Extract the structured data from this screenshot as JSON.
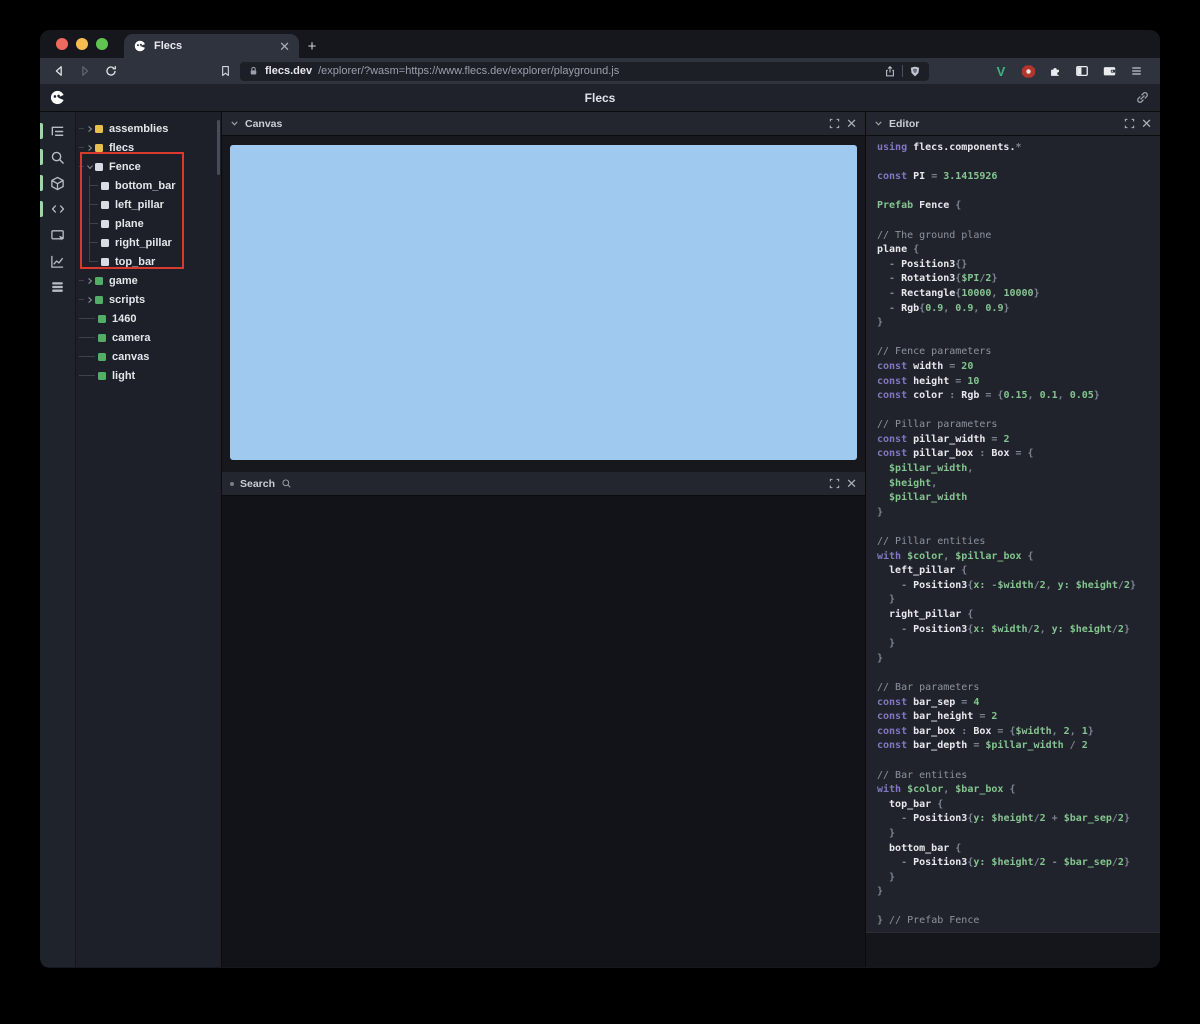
{
  "browser": {
    "tab_title": "Flecs",
    "new_tab_label": "+",
    "url_domain": "flecs.dev",
    "url_path": "/explorer/?wasm=https://www.flecs.dev/explorer/playground.js",
    "extensions": {
      "v_label": "V"
    }
  },
  "header": {
    "title": "Flecs"
  },
  "sidebar": {
    "items": [
      {
        "icon": "tree-view",
        "active": true
      },
      {
        "icon": "search",
        "active": true
      },
      {
        "icon": "cube",
        "active": true
      },
      {
        "icon": "code",
        "active": true
      },
      {
        "icon": "inspect",
        "active": false
      },
      {
        "icon": "chart",
        "active": false
      },
      {
        "icon": "rows",
        "active": false
      }
    ]
  },
  "tree": {
    "items": [
      {
        "label": "assemblies",
        "square": "yellow",
        "state": "collapsed"
      },
      {
        "label": "flecs",
        "square": "yellow",
        "state": "collapsed"
      },
      {
        "label": "Fence",
        "square": "white",
        "state": "expanded"
      },
      {
        "label": "bottom_bar",
        "square": "white",
        "state": "child"
      },
      {
        "label": "left_pillar",
        "square": "white",
        "state": "child"
      },
      {
        "label": "plane",
        "square": "white",
        "state": "child"
      },
      {
        "label": "right_pillar",
        "square": "white",
        "state": "child"
      },
      {
        "label": "top_bar",
        "square": "white",
        "state": "child-last"
      },
      {
        "label": "game",
        "square": "green",
        "state": "collapsed"
      },
      {
        "label": "scripts",
        "square": "green",
        "state": "collapsed"
      },
      {
        "label": "1460",
        "square": "green",
        "state": "leaf"
      },
      {
        "label": "camera",
        "square": "green",
        "state": "leaf"
      },
      {
        "label": "canvas",
        "square": "green",
        "state": "leaf"
      },
      {
        "label": "light",
        "square": "green",
        "state": "leaf"
      }
    ]
  },
  "panels": {
    "canvas_title": "Canvas",
    "search_title": "Search",
    "editor_title": "Editor"
  },
  "editor": {
    "lines": [
      [
        [
          "k",
          "using "
        ],
        [
          "i",
          "flecs.components."
        ],
        [
          "p",
          "*"
        ]
      ],
      [],
      [
        [
          "k",
          "const "
        ],
        [
          "i",
          "PI"
        ],
        [
          "p",
          " = "
        ],
        [
          "g",
          "3.1415926"
        ]
      ],
      [],
      [
        [
          "g",
          "Prefab "
        ],
        [
          "i",
          "Fence"
        ],
        [
          "p",
          " {"
        ]
      ],
      [],
      [
        [
          "c",
          "// The ground plane"
        ]
      ],
      [
        [
          "i",
          "plane"
        ],
        [
          "p",
          " {"
        ]
      ],
      [
        [
          "p",
          "  - "
        ],
        [
          "i",
          "Position3"
        ],
        [
          "p",
          "{}"
        ]
      ],
      [
        [
          "p",
          "  - "
        ],
        [
          "i",
          "Rotation3"
        ],
        [
          "p",
          "{"
        ],
        [
          "g",
          "$PI"
        ],
        [
          "p",
          "/"
        ],
        [
          "g",
          "2"
        ],
        [
          "p",
          "}"
        ]
      ],
      [
        [
          "p",
          "  - "
        ],
        [
          "i",
          "Rectangle"
        ],
        [
          "p",
          "{"
        ],
        [
          "g",
          "10000"
        ],
        [
          "p",
          ", "
        ],
        [
          "g",
          "10000"
        ],
        [
          "p",
          "}"
        ]
      ],
      [
        [
          "p",
          "  - "
        ],
        [
          "i",
          "Rgb"
        ],
        [
          "p",
          "{"
        ],
        [
          "g",
          "0.9"
        ],
        [
          "p",
          ", "
        ],
        [
          "g",
          "0.9"
        ],
        [
          "p",
          ", "
        ],
        [
          "g",
          "0.9"
        ],
        [
          "p",
          "}"
        ]
      ],
      [
        [
          "p",
          "}"
        ]
      ],
      [],
      [
        [
          "c",
          "// Fence parameters"
        ]
      ],
      [
        [
          "k",
          "const "
        ],
        [
          "i",
          "width"
        ],
        [
          "p",
          " = "
        ],
        [
          "g",
          "20"
        ]
      ],
      [
        [
          "k",
          "const "
        ],
        [
          "i",
          "height"
        ],
        [
          "p",
          " = "
        ],
        [
          "g",
          "10"
        ]
      ],
      [
        [
          "k",
          "const "
        ],
        [
          "i",
          "color"
        ],
        [
          "p",
          " : "
        ],
        [
          "i",
          "Rgb"
        ],
        [
          "p",
          " = {"
        ],
        [
          "g",
          "0.15"
        ],
        [
          "p",
          ", "
        ],
        [
          "g",
          "0.1"
        ],
        [
          "p",
          ", "
        ],
        [
          "g",
          "0.05"
        ],
        [
          "p",
          "}"
        ]
      ],
      [],
      [
        [
          "c",
          "// Pillar parameters"
        ]
      ],
      [
        [
          "k",
          "const "
        ],
        [
          "i",
          "pillar_width"
        ],
        [
          "p",
          " = "
        ],
        [
          "g",
          "2"
        ]
      ],
      [
        [
          "k",
          "const "
        ],
        [
          "i",
          "pillar_box"
        ],
        [
          "p",
          " : "
        ],
        [
          "i",
          "Box"
        ],
        [
          "p",
          " = {"
        ]
      ],
      [
        [
          "g",
          "  $pillar_width"
        ],
        [
          "p",
          ","
        ]
      ],
      [
        [
          "g",
          "  $height"
        ],
        [
          "p",
          ","
        ]
      ],
      [
        [
          "g",
          "  $pillar_width"
        ]
      ],
      [
        [
          "p",
          "}"
        ]
      ],
      [],
      [
        [
          "c",
          "// Pillar entities"
        ]
      ],
      [
        [
          "k",
          "with "
        ],
        [
          "g",
          "$color"
        ],
        [
          "p",
          ", "
        ],
        [
          "g",
          "$pillar_box"
        ],
        [
          "p",
          " {"
        ]
      ],
      [
        [
          "i",
          "  left_pillar"
        ],
        [
          "p",
          " {"
        ]
      ],
      [
        [
          "p",
          "    - "
        ],
        [
          "i",
          "Position3"
        ],
        [
          "p",
          "{"
        ],
        [
          "g",
          "x:"
        ],
        [
          "p",
          " -"
        ],
        [
          "g",
          "$width"
        ],
        [
          "p",
          "/"
        ],
        [
          "g",
          "2"
        ],
        [
          "p",
          ", "
        ],
        [
          "g",
          "y:"
        ],
        [
          "p",
          " "
        ],
        [
          "g",
          "$height"
        ],
        [
          "p",
          "/"
        ],
        [
          "g",
          "2"
        ],
        [
          "p",
          "}"
        ]
      ],
      [
        [
          "p",
          "  }"
        ]
      ],
      [
        [
          "i",
          "  right_pillar"
        ],
        [
          "p",
          " {"
        ]
      ],
      [
        [
          "p",
          "    - "
        ],
        [
          "i",
          "Position3"
        ],
        [
          "p",
          "{"
        ],
        [
          "g",
          "x:"
        ],
        [
          "p",
          " "
        ],
        [
          "g",
          "$width"
        ],
        [
          "p",
          "/"
        ],
        [
          "g",
          "2"
        ],
        [
          "p",
          ", "
        ],
        [
          "g",
          "y:"
        ],
        [
          "p",
          " "
        ],
        [
          "g",
          "$height"
        ],
        [
          "p",
          "/"
        ],
        [
          "g",
          "2"
        ],
        [
          "p",
          "}"
        ]
      ],
      [
        [
          "p",
          "  }"
        ]
      ],
      [
        [
          "p",
          "}"
        ]
      ],
      [],
      [
        [
          "c",
          "// Bar parameters"
        ]
      ],
      [
        [
          "k",
          "const "
        ],
        [
          "i",
          "bar_sep"
        ],
        [
          "p",
          " = "
        ],
        [
          "g",
          "4"
        ]
      ],
      [
        [
          "k",
          "const "
        ],
        [
          "i",
          "bar_height"
        ],
        [
          "p",
          " = "
        ],
        [
          "g",
          "2"
        ]
      ],
      [
        [
          "k",
          "const "
        ],
        [
          "i",
          "bar_box"
        ],
        [
          "p",
          " : "
        ],
        [
          "i",
          "Box"
        ],
        [
          "p",
          " = {"
        ],
        [
          "g",
          "$width"
        ],
        [
          "p",
          ", "
        ],
        [
          "g",
          "2"
        ],
        [
          "p",
          ", "
        ],
        [
          "g",
          "1"
        ],
        [
          "p",
          "}"
        ]
      ],
      [
        [
          "k",
          "const "
        ],
        [
          "i",
          "bar_depth"
        ],
        [
          "p",
          " = "
        ],
        [
          "g",
          "$pillar_width"
        ],
        [
          "p",
          " / "
        ],
        [
          "g",
          "2"
        ]
      ],
      [],
      [
        [
          "c",
          "// Bar entities"
        ]
      ],
      [
        [
          "k",
          "with "
        ],
        [
          "g",
          "$color"
        ],
        [
          "p",
          ", "
        ],
        [
          "g",
          "$bar_box"
        ],
        [
          "p",
          " {"
        ]
      ],
      [
        [
          "i",
          "  top_bar"
        ],
        [
          "p",
          " {"
        ]
      ],
      [
        [
          "p",
          "    - "
        ],
        [
          "i",
          "Position3"
        ],
        [
          "p",
          "{"
        ],
        [
          "g",
          "y:"
        ],
        [
          "p",
          " "
        ],
        [
          "g",
          "$height"
        ],
        [
          "p",
          "/"
        ],
        [
          "g",
          "2"
        ],
        [
          "p",
          " + "
        ],
        [
          "g",
          "$bar_sep"
        ],
        [
          "p",
          "/"
        ],
        [
          "g",
          "2"
        ],
        [
          "p",
          "}"
        ]
      ],
      [
        [
          "p",
          "  }"
        ]
      ],
      [
        [
          "i",
          "  bottom_bar"
        ],
        [
          "p",
          " {"
        ]
      ],
      [
        [
          "p",
          "    - "
        ],
        [
          "i",
          "Position3"
        ],
        [
          "p",
          "{"
        ],
        [
          "g",
          "y:"
        ],
        [
          "p",
          " "
        ],
        [
          "g",
          "$height"
        ],
        [
          "p",
          "/"
        ],
        [
          "g",
          "2"
        ],
        [
          "p",
          " - "
        ],
        [
          "g",
          "$bar_sep"
        ],
        [
          "p",
          "/"
        ],
        [
          "g",
          "2"
        ],
        [
          "p",
          "}"
        ]
      ],
      [
        [
          "p",
          "  }"
        ]
      ],
      [
        [
          "p",
          "}"
        ]
      ],
      [],
      [
        [
          "p",
          "} "
        ],
        [
          "c",
          "// Prefab Fence"
        ]
      ]
    ]
  },
  "colors": {
    "canvas_blue": "#a0c9f0",
    "highlight_red": "#d93a2b",
    "square_yellow": "#e5c14a",
    "square_green": "#52ad66",
    "square_white": "#d9dce2",
    "active_pill_green": "#9fd7a9",
    "code_keyword": "#8177c6",
    "code_identifier": "#e7e9ee",
    "code_green": "#83c48f",
    "code_comment": "#8b93a1",
    "code_punct": "#7c8494",
    "vue_green": "#3fb27f",
    "adblock_red": "#b5342c"
  }
}
